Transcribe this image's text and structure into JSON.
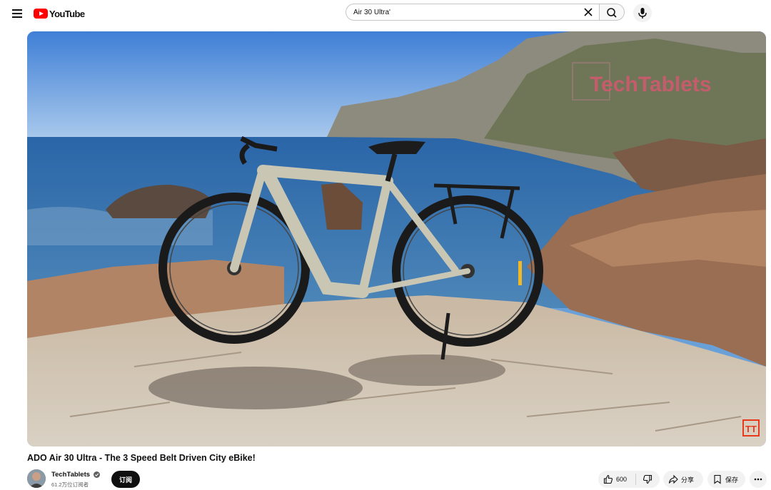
{
  "header": {
    "logo_text": "YouTube",
    "search_value": "Air 30 Ultra'",
    "icons": {
      "menu": "menu-icon",
      "clear": "close-icon",
      "search": "search-icon",
      "mic": "mic-icon"
    }
  },
  "video": {
    "watermark": "TechTablets",
    "corner_logo": "TT",
    "title": "ADO Air 30 Ultra - The 3 Speed Belt Driven City eBike!"
  },
  "channel": {
    "name": "TechTablets",
    "subscribers": "61.2万位订阅者",
    "subscribe_label": "订阅"
  },
  "actions": {
    "like_count": "600",
    "share_label": "分享",
    "save_label": "保存"
  },
  "colors": {
    "brand": "#ff0000",
    "text": "#0f0f0f",
    "secondary_text": "#606060",
    "pill_bg": "#f2f2f2"
  }
}
